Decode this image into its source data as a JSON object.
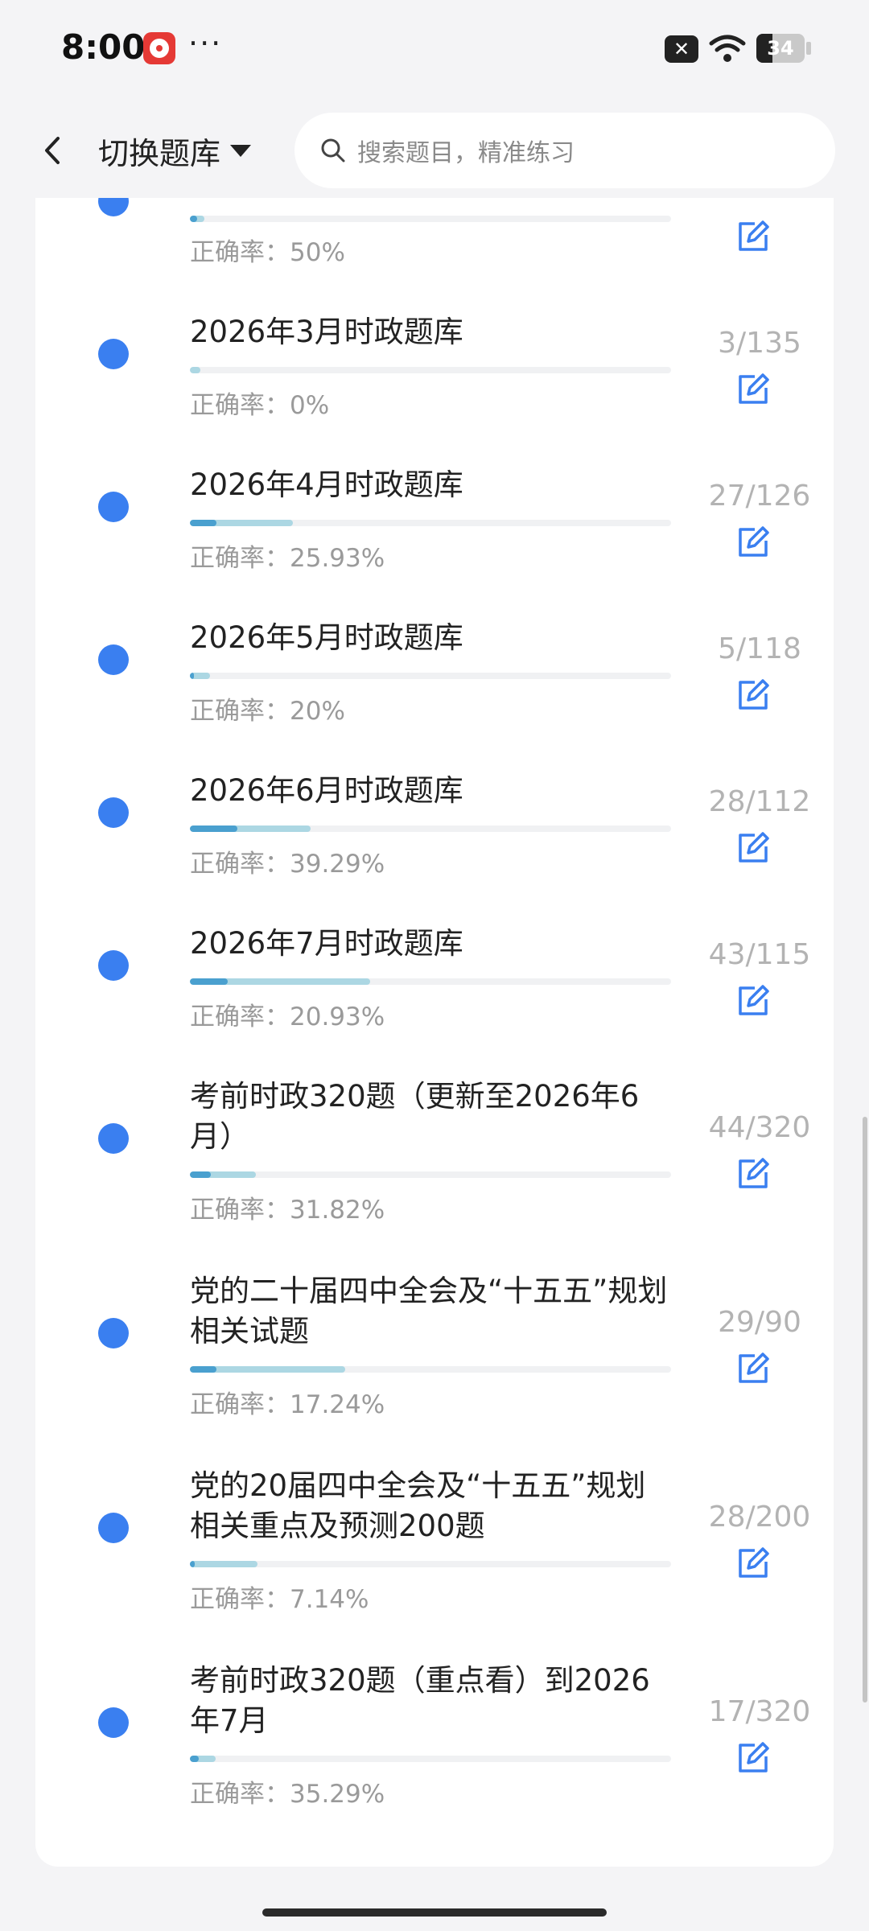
{
  "status_bar": {
    "time": "8:00",
    "dots": "···",
    "battery_level": "34",
    "icons": [
      "app-icon",
      "close-box-icon",
      "wifi-icon",
      "battery-icon"
    ]
  },
  "nav": {
    "back_icon": "chevron-left-icon",
    "bank_switch_label": "切换题库",
    "search_placeholder": "搜索题目，精准练习"
  },
  "accent_color": "#3a7ff0",
  "items": [
    {
      "title": "",
      "count": "",
      "accuracy": "正确率：50%",
      "progress_total": 0.03,
      "progress_correct": 0.015
    },
    {
      "title": "2026年3月时政题库",
      "count": "3/135",
      "accuracy": "正确率：0%",
      "progress_total": 0.022,
      "progress_correct": 0.0
    },
    {
      "title": "2026年4月时政题库",
      "count": "27/126",
      "accuracy": "正确率：25.93%",
      "progress_total": 0.214,
      "progress_correct": 0.055
    },
    {
      "title": "2026年5月时政题库",
      "count": "5/118",
      "accuracy": "正确率：20%",
      "progress_total": 0.042,
      "progress_correct": 0.008
    },
    {
      "title": "2026年6月时政题库",
      "count": "28/112",
      "accuracy": "正确率：39.29%",
      "progress_total": 0.25,
      "progress_correct": 0.098
    },
    {
      "title": "2026年7月时政题库",
      "count": "43/115",
      "accuracy": "正确率：20.93%",
      "progress_total": 0.374,
      "progress_correct": 0.078
    },
    {
      "title": "考前时政320题（更新至2026年6月）",
      "count": "44/320",
      "accuracy": "正确率：31.82%",
      "progress_total": 0.1375,
      "progress_correct": 0.044
    },
    {
      "title": "党的二十届四中全会及“十五五”规划相关试题",
      "count": "29/90",
      "accuracy": "正确率：17.24%",
      "progress_total": 0.322,
      "progress_correct": 0.056
    },
    {
      "title": "党的20届四中全会及“十五五”规划相关重点及预测200题",
      "count": "28/200",
      "accuracy": "正确率：7.14%",
      "progress_total": 0.14,
      "progress_correct": 0.01
    },
    {
      "title": "考前时政320题（重点看）到2026年7月",
      "count": "17/320",
      "accuracy": "正确率：35.29%",
      "progress_total": 0.053,
      "progress_correct": 0.019
    }
  ]
}
